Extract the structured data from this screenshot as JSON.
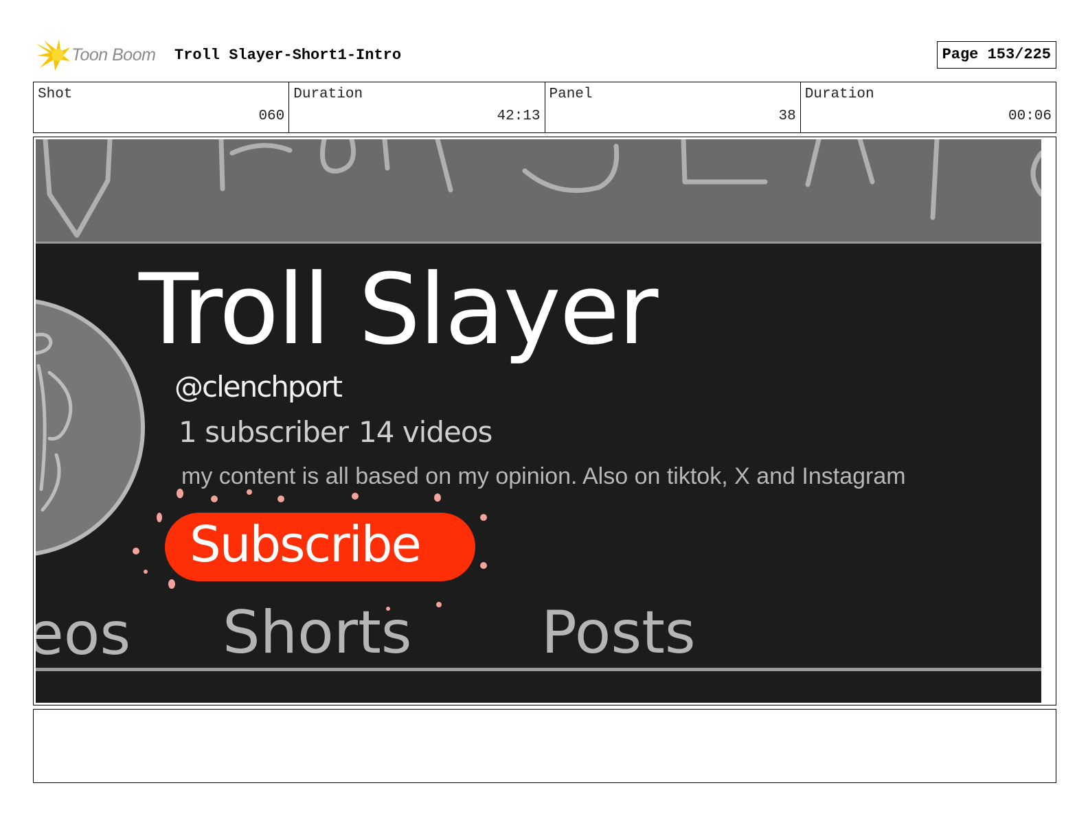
{
  "header": {
    "logo_text": "Toon Boom",
    "project_title": "Troll Slayer-Short1-Intro",
    "page": "Page 153/225"
  },
  "info": {
    "shot_label": "Shot",
    "shot_value": "060",
    "shot_duration_label": "Duration",
    "shot_duration_value": "42:13",
    "panel_label": "Panel",
    "panel_value": "38",
    "panel_duration_label": "Duration",
    "panel_duration_value": "00:06"
  },
  "panel": {
    "channel_name": "Troll Slayer",
    "handle": "@clenchport",
    "subscribers": "1 subscriber",
    "videos": "14 videos",
    "description": "my content is all based on my opinion. Also on tiktok, X and Instagram",
    "subscribe_label": "Subscribe",
    "tabs": [
      "leos",
      "Shorts",
      "Posts"
    ],
    "colors": {
      "background": "#1c1c1c",
      "banner": "#6b6b6b",
      "subscribe": "#fe2e06",
      "sparkle": "#f4a39a"
    }
  },
  "notes": ""
}
